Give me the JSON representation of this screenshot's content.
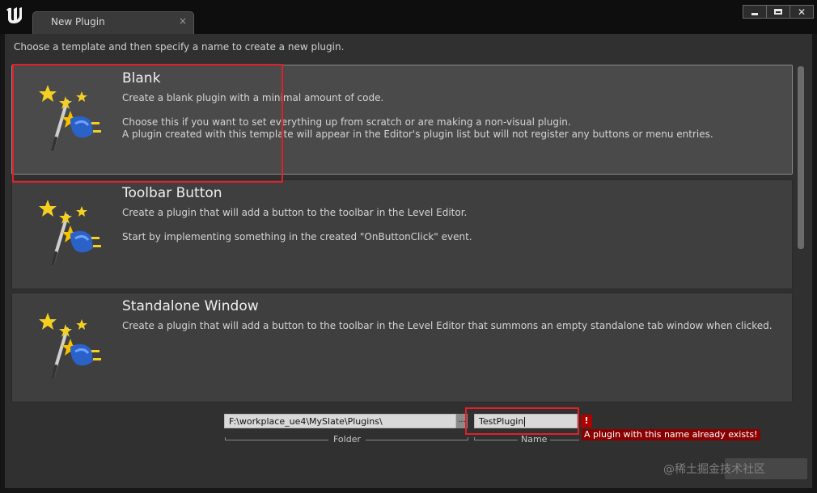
{
  "window": {
    "tab_title": "New Plugin",
    "tab_close": "×",
    "controls": {
      "minimize": "minimize",
      "maximize": "maximize",
      "close": "✕"
    }
  },
  "instruction": "Choose a template and then specify a name to create a new plugin.",
  "templates": [
    {
      "title": "Blank",
      "description": "Create a blank plugin with a minimal amount of code.\n\nChoose this if you want to set everything up from scratch or are making a non-visual plugin.\nA plugin created with this template will appear in the Editor's plugin list but will not register any buttons or menu entries.",
      "selected": true
    },
    {
      "title": "Toolbar Button",
      "description": "Create a plugin that will add a button to the toolbar in the Level Editor.\n\nStart by implementing something in the created \"OnButtonClick\" event.",
      "selected": false
    },
    {
      "title": "Standalone Window",
      "description": "Create a plugin that will add a button to the toolbar in the Level Editor that summons an empty standalone tab window when clicked.",
      "selected": false
    }
  ],
  "form": {
    "folder_value": "F:\\workplace_ue4\\MySlate\\Plugins\\",
    "folder_label": "Folder",
    "browse_label": "...",
    "name_value": "TestPlugin",
    "name_label": "Name",
    "error_icon": "!",
    "error_message": "A plugin with this name already exists!"
  },
  "watermark": "@稀土掘金技术社区",
  "colors": {
    "highlight": "#e0202a",
    "error": "#8a0000",
    "background": "#303030"
  },
  "icons": {
    "app_logo": "unreal-engine-logo",
    "template_icon": "magic-wand-plugin-icon"
  }
}
